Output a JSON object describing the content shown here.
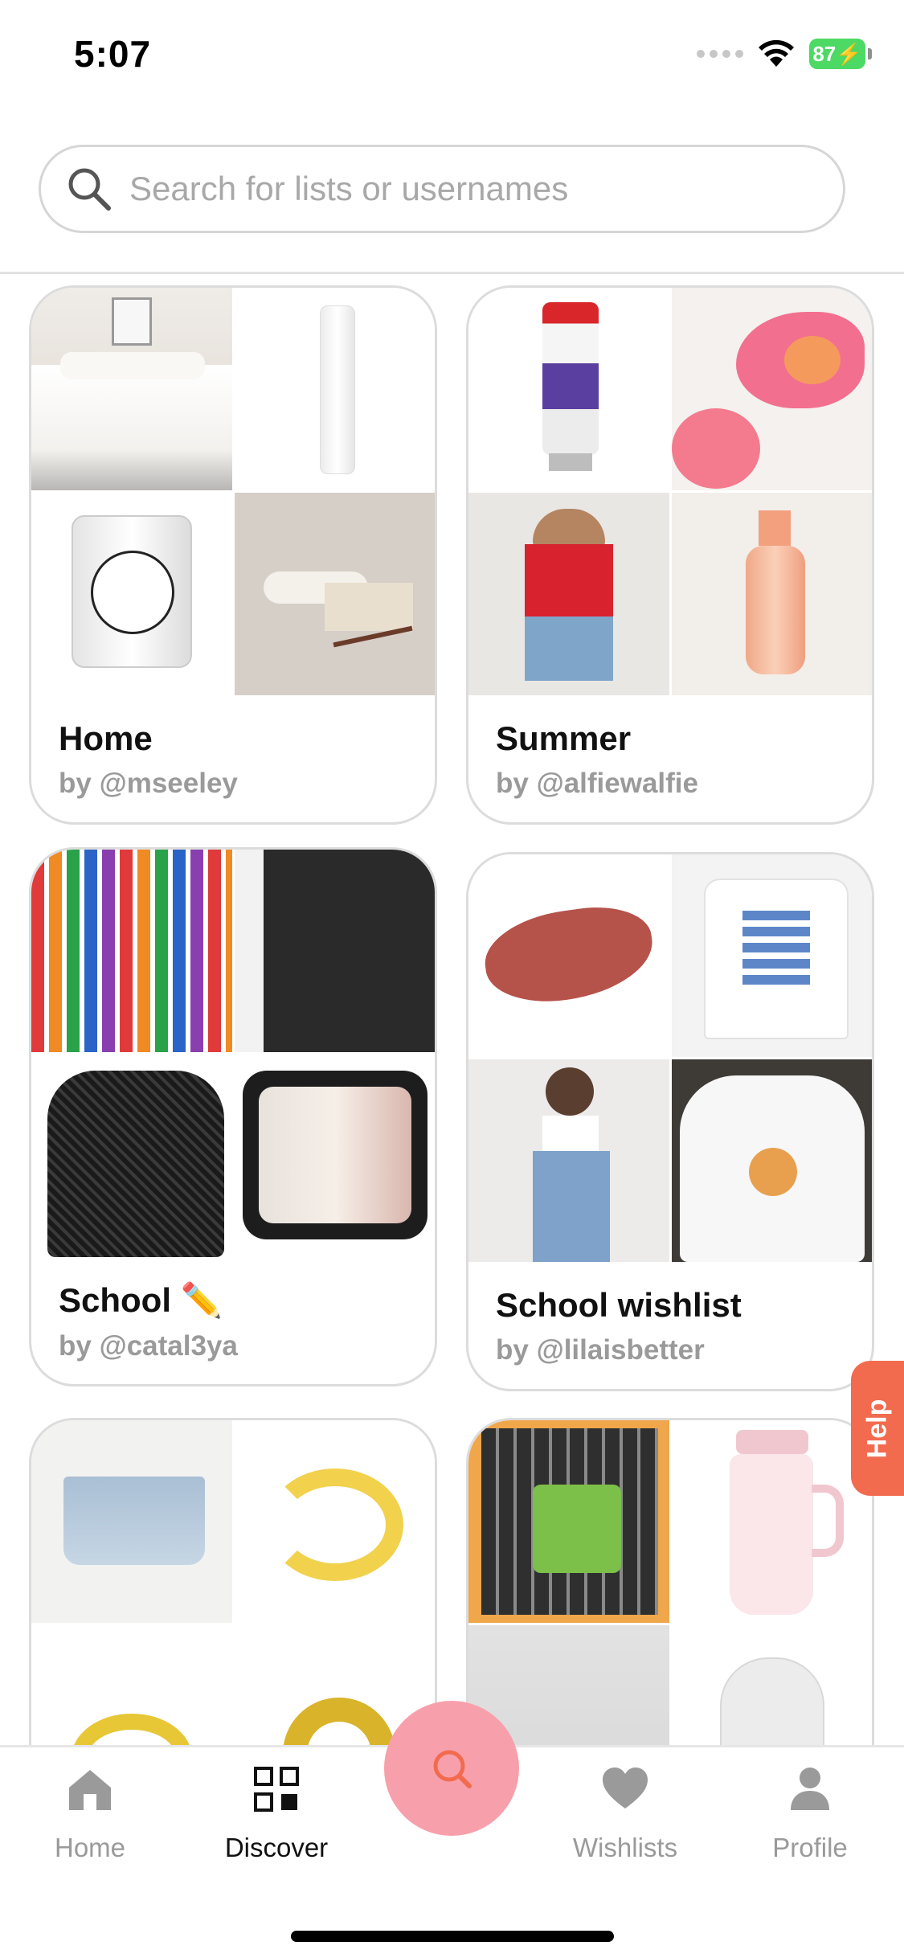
{
  "status_bar": {
    "time": "5:07",
    "battery": "87"
  },
  "search": {
    "placeholder": "Search for lists or usernames"
  },
  "lists": [
    {
      "title": "Home",
      "by": "by @mseeley",
      "thumbs": [
        "duvet-bed",
        "spray-bottle",
        "candle",
        "incense-sticks"
      ]
    },
    {
      "title": "Summer",
      "by": "by @alfiewalfie",
      "thumbs": [
        "toothpaste",
        "floral-top",
        "red-tank-top",
        "body-mist"
      ]
    },
    {
      "title": "School ✏️",
      "by": "by @catal3ya",
      "thumbs": [
        "gel-pens",
        "black-binder",
        "mesh-backpack",
        "clear-pouch"
      ]
    },
    {
      "title": "School wishlist",
      "by": "by @lilaisbetter",
      "thumbs": [
        "lip-swatch",
        "brooklyn-tee",
        "wide-leg-jeans",
        "white-hoodie"
      ]
    },
    {
      "thumbs": [
        "denim-skirt",
        "gold-ear-cuff",
        "gold-ring",
        "gold-chunky-ring"
      ]
    },
    {
      "thumbs": [
        "mechanical-pencils",
        "pink-tumbler",
        "gray-item",
        "white-backpack"
      ]
    }
  ],
  "help": {
    "label": "Help"
  },
  "tabbar": {
    "items": [
      {
        "label": "Home",
        "icon": "home-icon"
      },
      {
        "label": "Discover",
        "icon": "grid-icon"
      },
      {
        "label": "Wishlists",
        "icon": "heart-icon"
      },
      {
        "label": "Profile",
        "icon": "person-icon"
      }
    ],
    "center_icon": "search-icon",
    "active": "Discover"
  },
  "colors": {
    "accent": "#f26b4f",
    "fab": "#f7a0ab",
    "battery": "#4cd964"
  }
}
